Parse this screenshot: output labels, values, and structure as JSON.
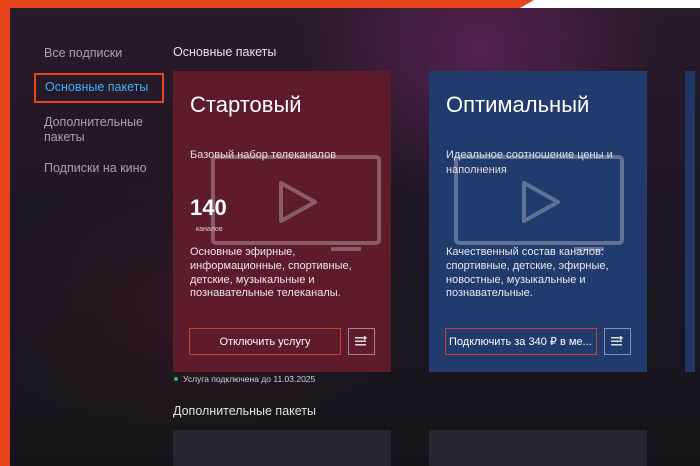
{
  "sidebar": {
    "items": [
      {
        "label": "Все подписки"
      },
      {
        "label": "Основные пакеты"
      },
      {
        "label": "Дополнительные пакеты"
      },
      {
        "label": "Подписки на кино"
      }
    ]
  },
  "main": {
    "section_title": "Основные пакеты",
    "section2_title": "Дополнительные пакеты",
    "cards": [
      {
        "name": "Стартовый",
        "subtitle": "Базовый набор телеканалов",
        "count": "140",
        "count_label": "каналов",
        "description": "Основные эфирные, информационные, спортивные, детские, музыкальные и познавательные телеканалы.",
        "button_label": "Отключить услугу",
        "bg_color": "#5e1c2b"
      },
      {
        "name": "Оптимальный",
        "subtitle": "Идеальное соотношение цены и наполнения",
        "description": "Качественный состав каналов: спортивные, детские, эфирные, новостные, музыкальные и познавательные.",
        "button_label": "Подключить за 340 ₽ в ме...",
        "bg_color": "#223b6e"
      }
    ],
    "status_text": "Услуга подключена до 11.03.2025"
  },
  "colors": {
    "accent_orange": "#e8441c",
    "active_blue": "#38b6ff",
    "status_green": "#22c55e"
  },
  "icons": [
    "tv-play-icon",
    "info-list-icon",
    "status-dot-icon"
  ]
}
